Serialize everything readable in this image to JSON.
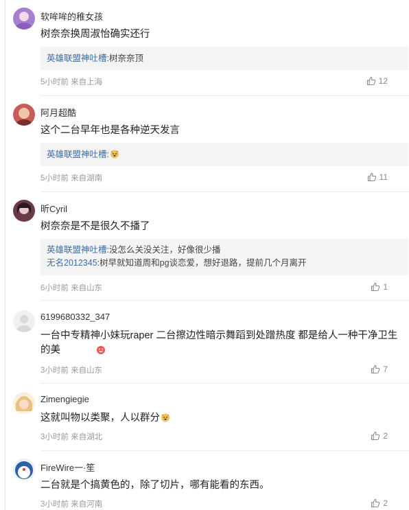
{
  "comments": [
    {
      "username": "软哞哞的稚女孩",
      "text": "树奈奈换周淑怡确实还行",
      "replies": [
        {
          "author": "英雄联盟神吐槽",
          "sep": ":",
          "content": "树奈奈顶"
        }
      ],
      "time": "5小时前",
      "location": "来自上海",
      "likes": "12",
      "avatar_color": "#a77fd0"
    },
    {
      "username": "阿月超酷",
      "text": "这个二台早年也是各种逆天发言",
      "replies": [
        {
          "author": "英雄联盟神吐槽",
          "sep": ":",
          "content": ""
        }
      ],
      "time": "5小时前",
      "location": "来自湖南",
      "likes": "11",
      "avatar_color": "#c85a5a"
    },
    {
      "username": "昕Cyril",
      "text": "树奈奈是不是很久不播了",
      "replies": [
        {
          "author": "英雄联盟神吐槽",
          "sep": ":",
          "content": "没怎么关没关注，好像很少播"
        },
        {
          "author": "无名2012345",
          "sep": ":",
          "content": "树早就知道周和pg谈恋爱，想好退路，提前几个月离开"
        }
      ],
      "time": "6小时前",
      "location": "来自山东",
      "likes": "1",
      "avatar_color": "#6b3a4a"
    },
    {
      "username": "6199680332_347",
      "text": "一台中专精神小妹玩raper 二台擦边性暗示舞蹈到处蹭热度 都是给人一种干净卫生的美",
      "replies": [],
      "time": "3小时前",
      "location": "来自山东",
      "likes": "7",
      "avatar_color": "#d9d9d9"
    },
    {
      "username": "Zimengiegie",
      "text": "这就叫物以类聚，人以群分",
      "replies": [],
      "time": "3小时前",
      "location": "来自湖北",
      "likes": "2",
      "avatar_color": "#e8c27a"
    },
    {
      "username": "FireWire一·笙",
      "text": "二台就是个搞黄色的，除了切片，哪有能看的东西。",
      "replies": [],
      "time": "3小时前",
      "location": "来自河南",
      "likes": "2",
      "avatar_color": "#2f5fa8"
    }
  ]
}
